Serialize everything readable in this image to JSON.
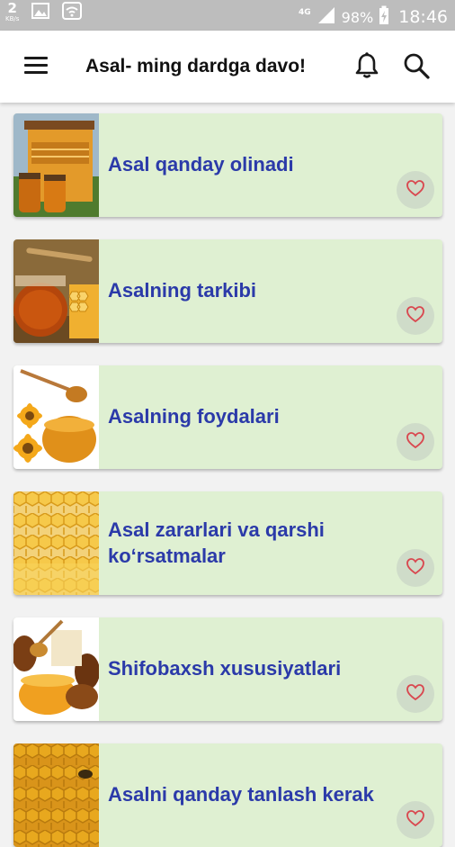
{
  "status_bar": {
    "net_speed": "2",
    "net_unit": "KB/s",
    "network_type": "4G",
    "battery": "98%",
    "time": "18:46",
    "icons": [
      "image-icon",
      "wifi-icon",
      "signal-icon",
      "battery-icon"
    ]
  },
  "app_bar": {
    "title": "Asal- ming dardga davo!",
    "icons": [
      "menu-icon",
      "bell-icon",
      "search-icon"
    ]
  },
  "items": [
    {
      "title": "Asal qanday olinadi",
      "image": "beehive-honey-jars",
      "favorited": false
    },
    {
      "title": "Asalning tarkibi",
      "image": "honey-jar-honeycomb",
      "favorited": false
    },
    {
      "title": "Asalning foydalari",
      "image": "honey-dipper-flowers",
      "favorited": false
    },
    {
      "title": "Asal zararlari va qarshi koʻrsatmalar",
      "image": "honeycomb",
      "favorited": false
    },
    {
      "title": "Shifobaxsh xususiyatlari",
      "image": "honey-bowl-dipper",
      "favorited": false
    },
    {
      "title": "Asalni qanday tanlash kerak",
      "image": "honeycomb-bees",
      "favorited": false
    }
  ],
  "colors": {
    "card_bg": "#dff0d2",
    "title_text": "#2b3aa9",
    "heart": "#d9474f",
    "status_bar": "#bdbdbd"
  }
}
